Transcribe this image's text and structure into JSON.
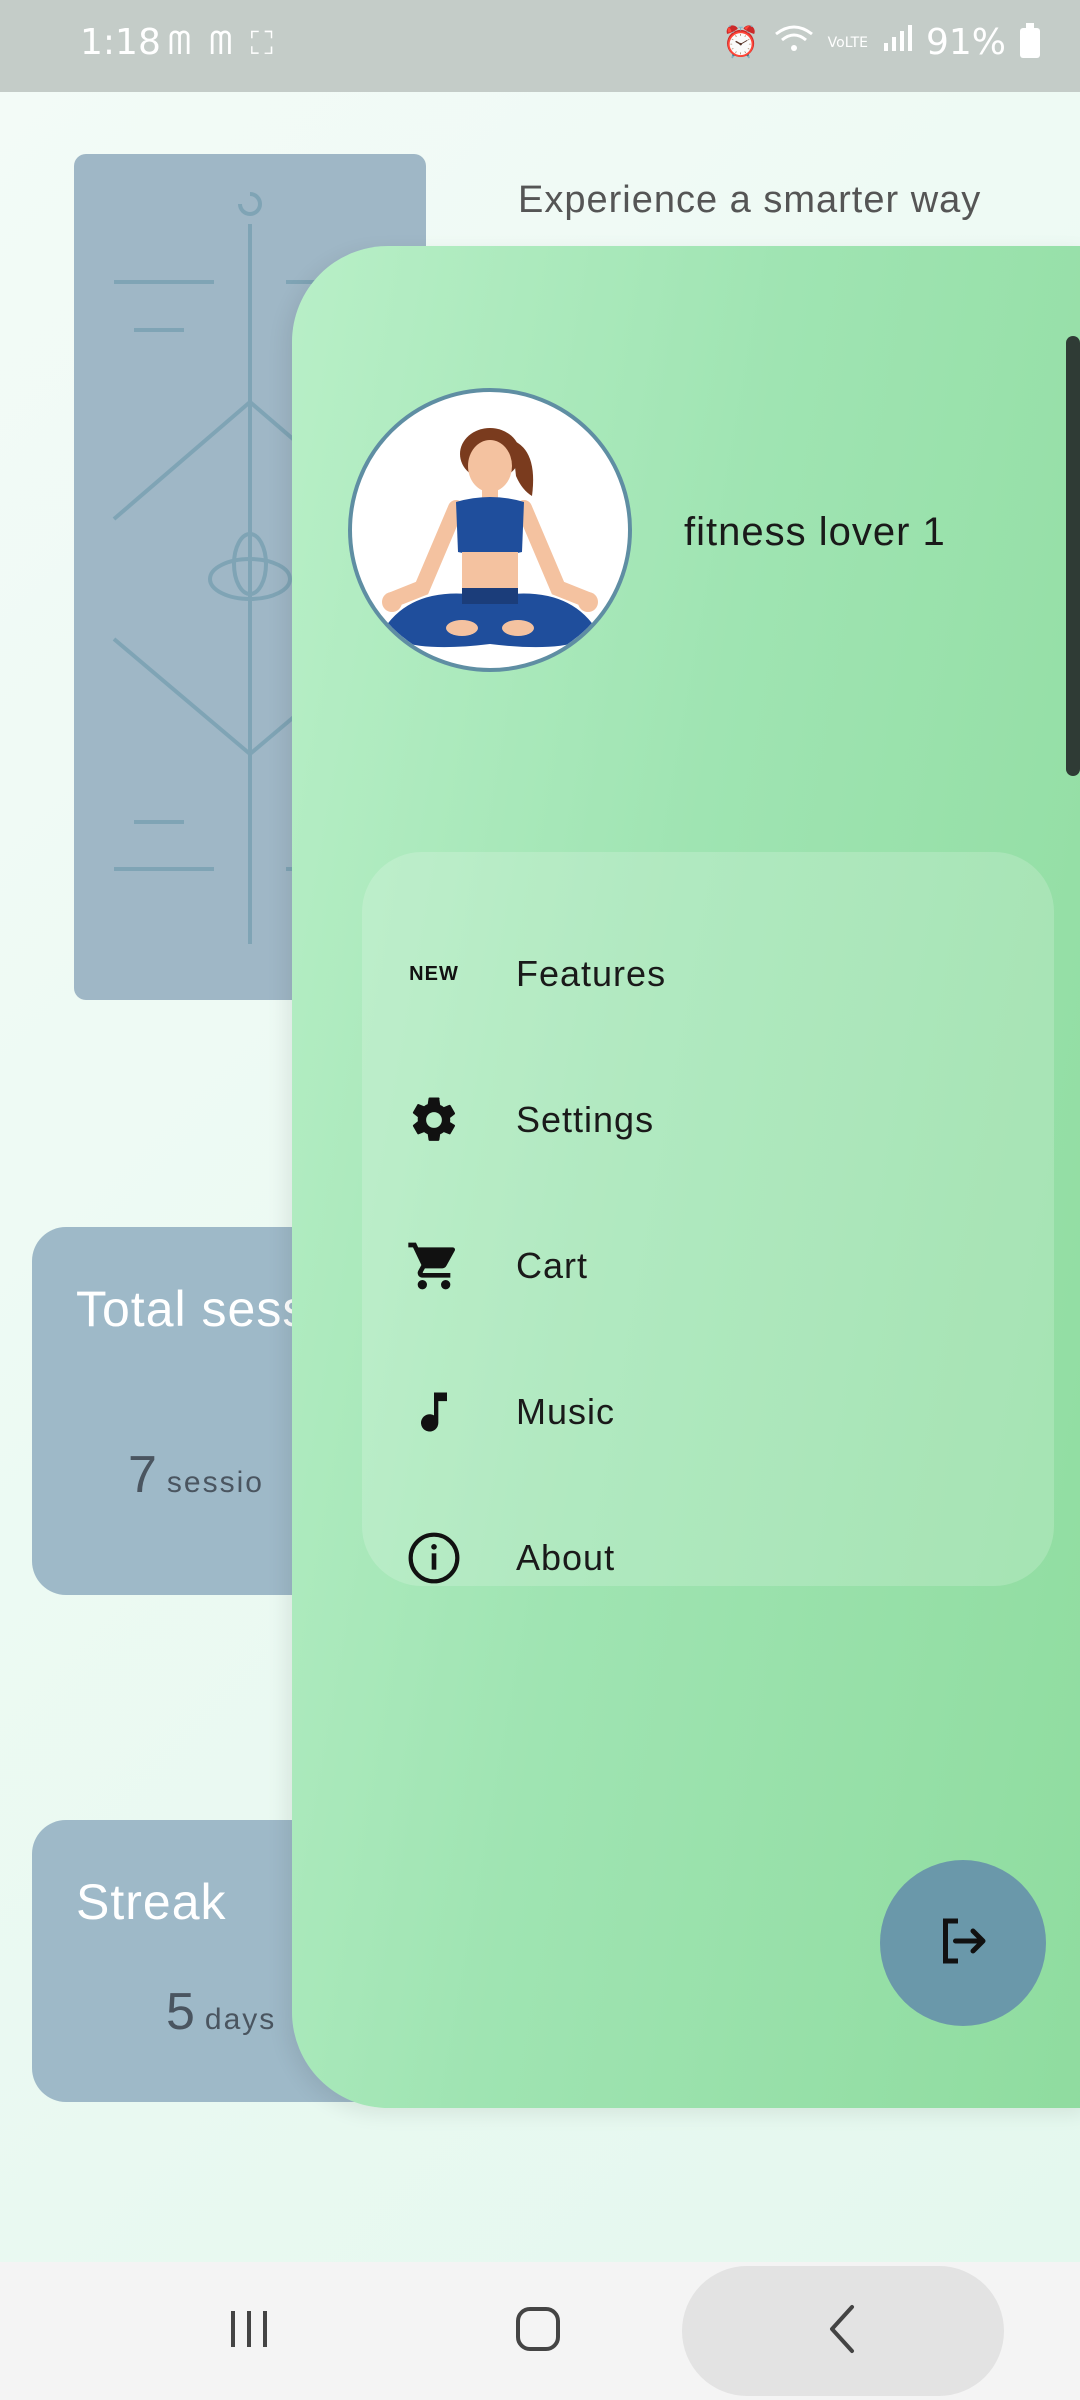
{
  "status_bar": {
    "time": "1:18",
    "left_icons": "ᗰ ᗰ ⛶",
    "network_label": "VoLTE",
    "battery": "91%"
  },
  "home": {
    "intro_text": "Experience a smarter way",
    "sessions_card": {
      "title": "Total sessions",
      "value": "7",
      "unit": "sessio"
    },
    "streak_card": {
      "title": "Streak",
      "value": "5",
      "unit": "days"
    }
  },
  "drawer": {
    "profile_name": "fitness lover 1",
    "menu": [
      {
        "label": "Features",
        "icon": "new-icon",
        "badge": "NEW"
      },
      {
        "label": "Settings",
        "icon": "gear-icon"
      },
      {
        "label": "Cart",
        "icon": "cart-icon"
      },
      {
        "label": "Music",
        "icon": "music-note-icon"
      },
      {
        "label": "About",
        "icon": "info-icon"
      }
    ],
    "logout_icon": "logout-icon"
  },
  "nav_bar": {
    "buttons": [
      "recents-icon",
      "home-icon",
      "back-icon"
    ]
  },
  "colors": {
    "drawer_start": "#b8efc7",
    "drawer_end": "#8fdc9f",
    "card_bg": "#9eb9c8",
    "fab_bg": "#6a98aa"
  }
}
